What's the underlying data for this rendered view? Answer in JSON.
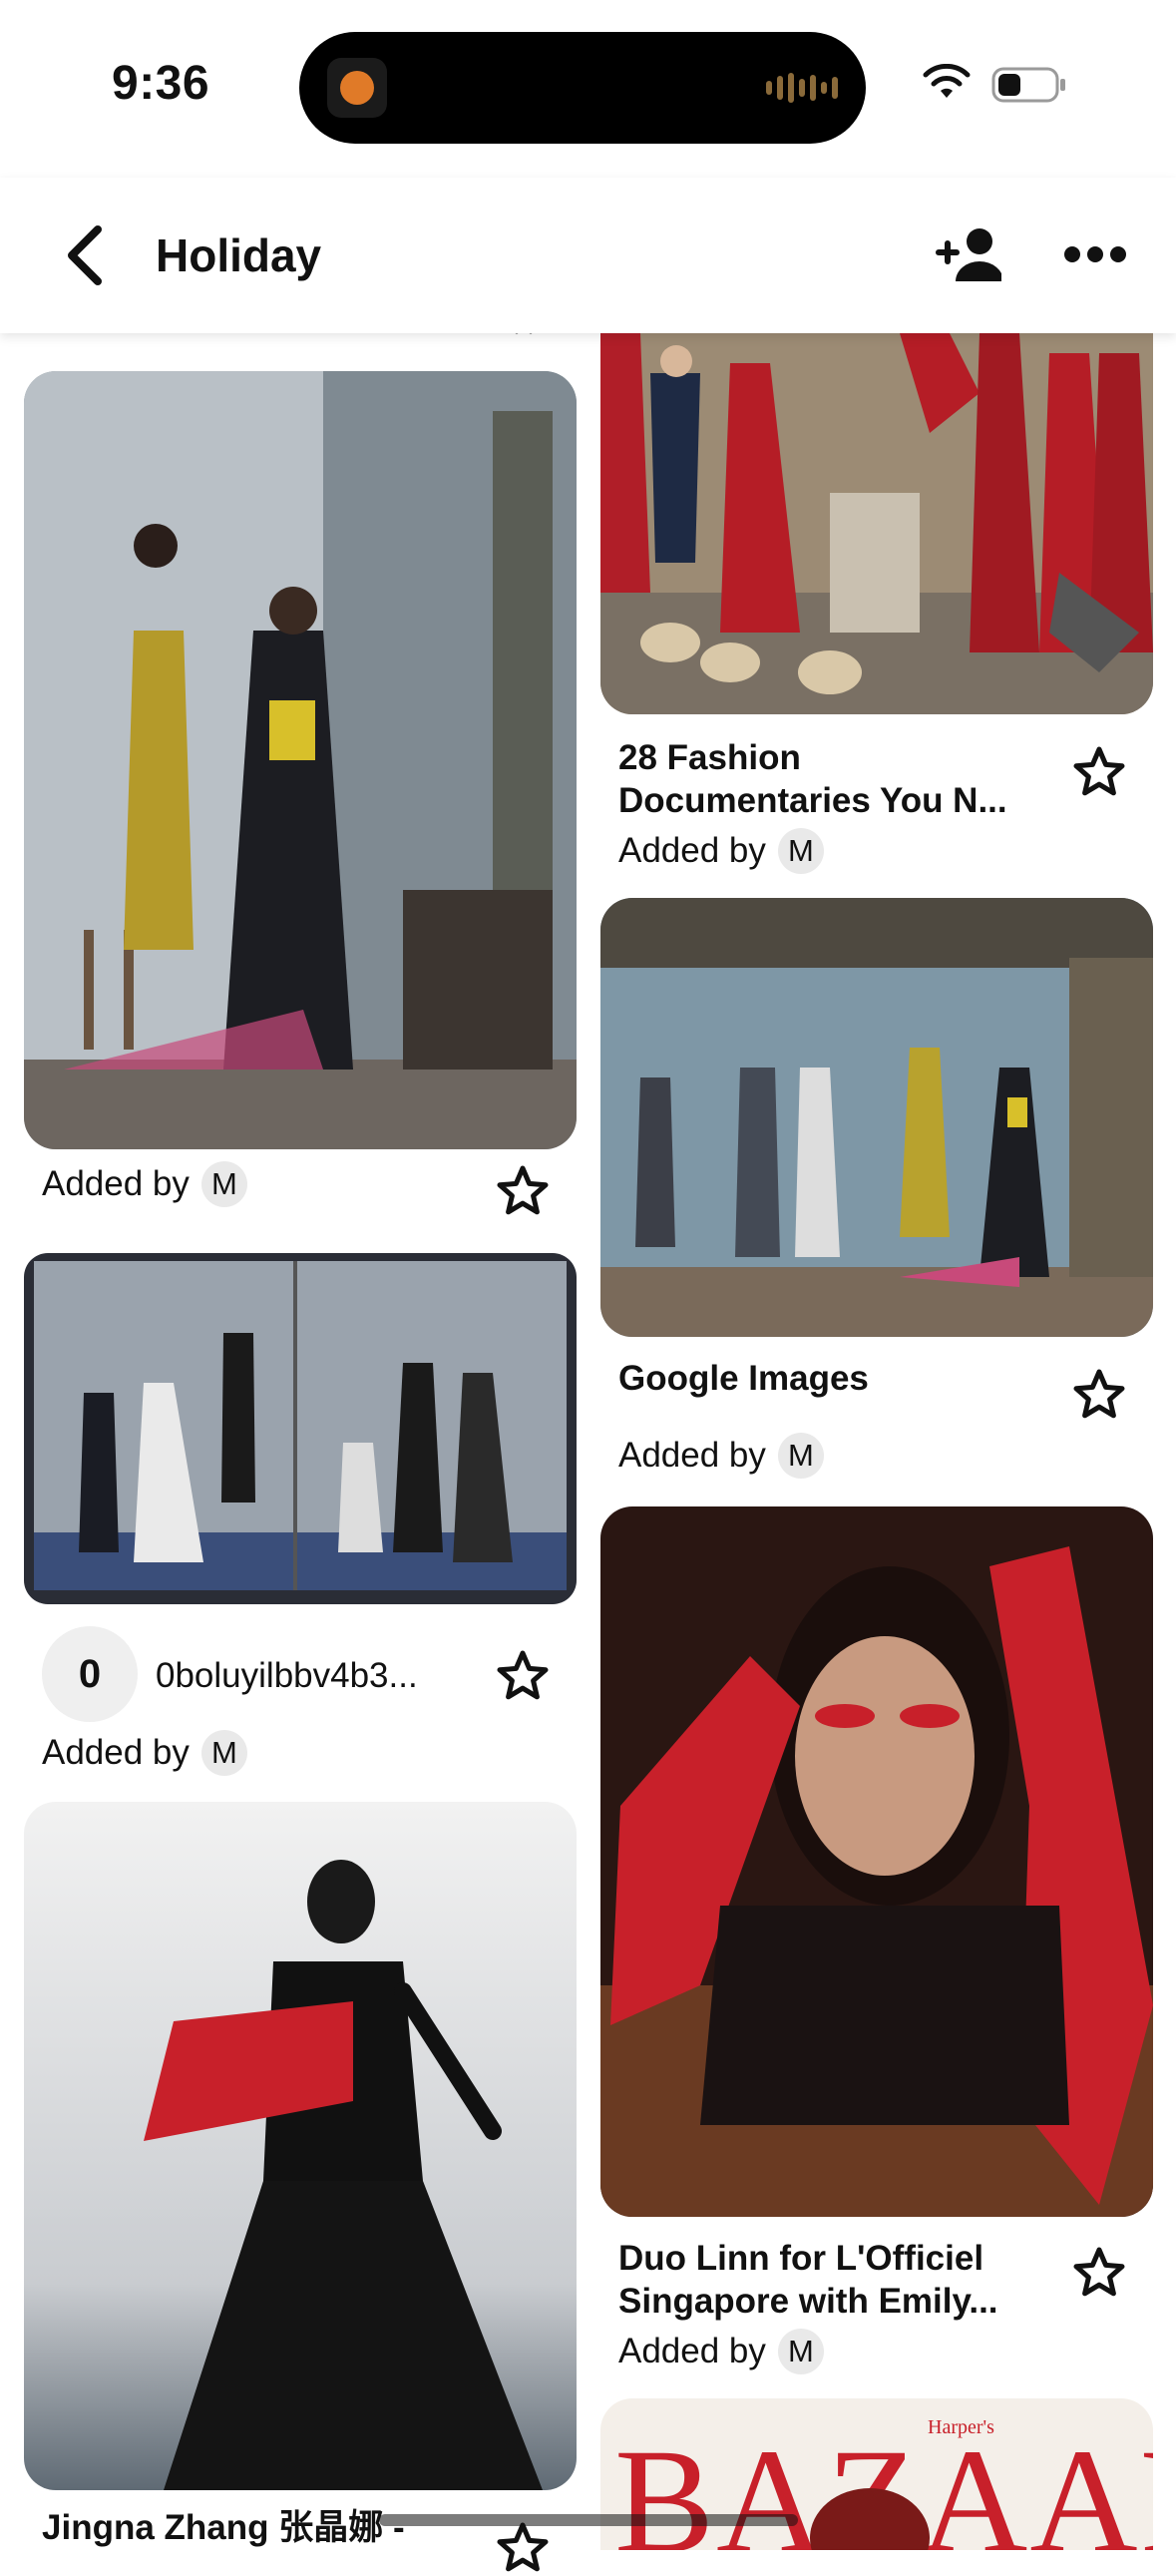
{
  "status_bar": {
    "time": "9:36"
  },
  "header": {
    "title": "Holiday"
  },
  "pins": {
    "left_1": {
      "added_by_label": "Added by",
      "avatar_initial": "M"
    },
    "left_2": {
      "count": "0",
      "source": "0boluyilbbv4b3...",
      "added_by_label": "Added by",
      "avatar_initial": "M"
    },
    "left_3": {
      "title": "Jingna Zhang 张晶娜 -"
    },
    "right_1": {
      "title_line1": "28 Fashion",
      "title_line2": "Documentaries You N...",
      "added_by_label": "Added by",
      "avatar_initial": "M"
    },
    "right_2": {
      "title": "Google Images",
      "added_by_label": "Added by",
      "avatar_initial": "M"
    },
    "right_3": {
      "title_line1": "Duo Linn for L'Officiel",
      "title_line2": "Singapore with Emily...",
      "added_by_label": "Added by",
      "avatar_initial": "M"
    },
    "right_4": {
      "masthead": "BAZAAR",
      "masthead_small": "Harper's"
    }
  },
  "colors": {
    "accent_red": "#c8202a",
    "avatar_bg": "#e9e9e9"
  }
}
